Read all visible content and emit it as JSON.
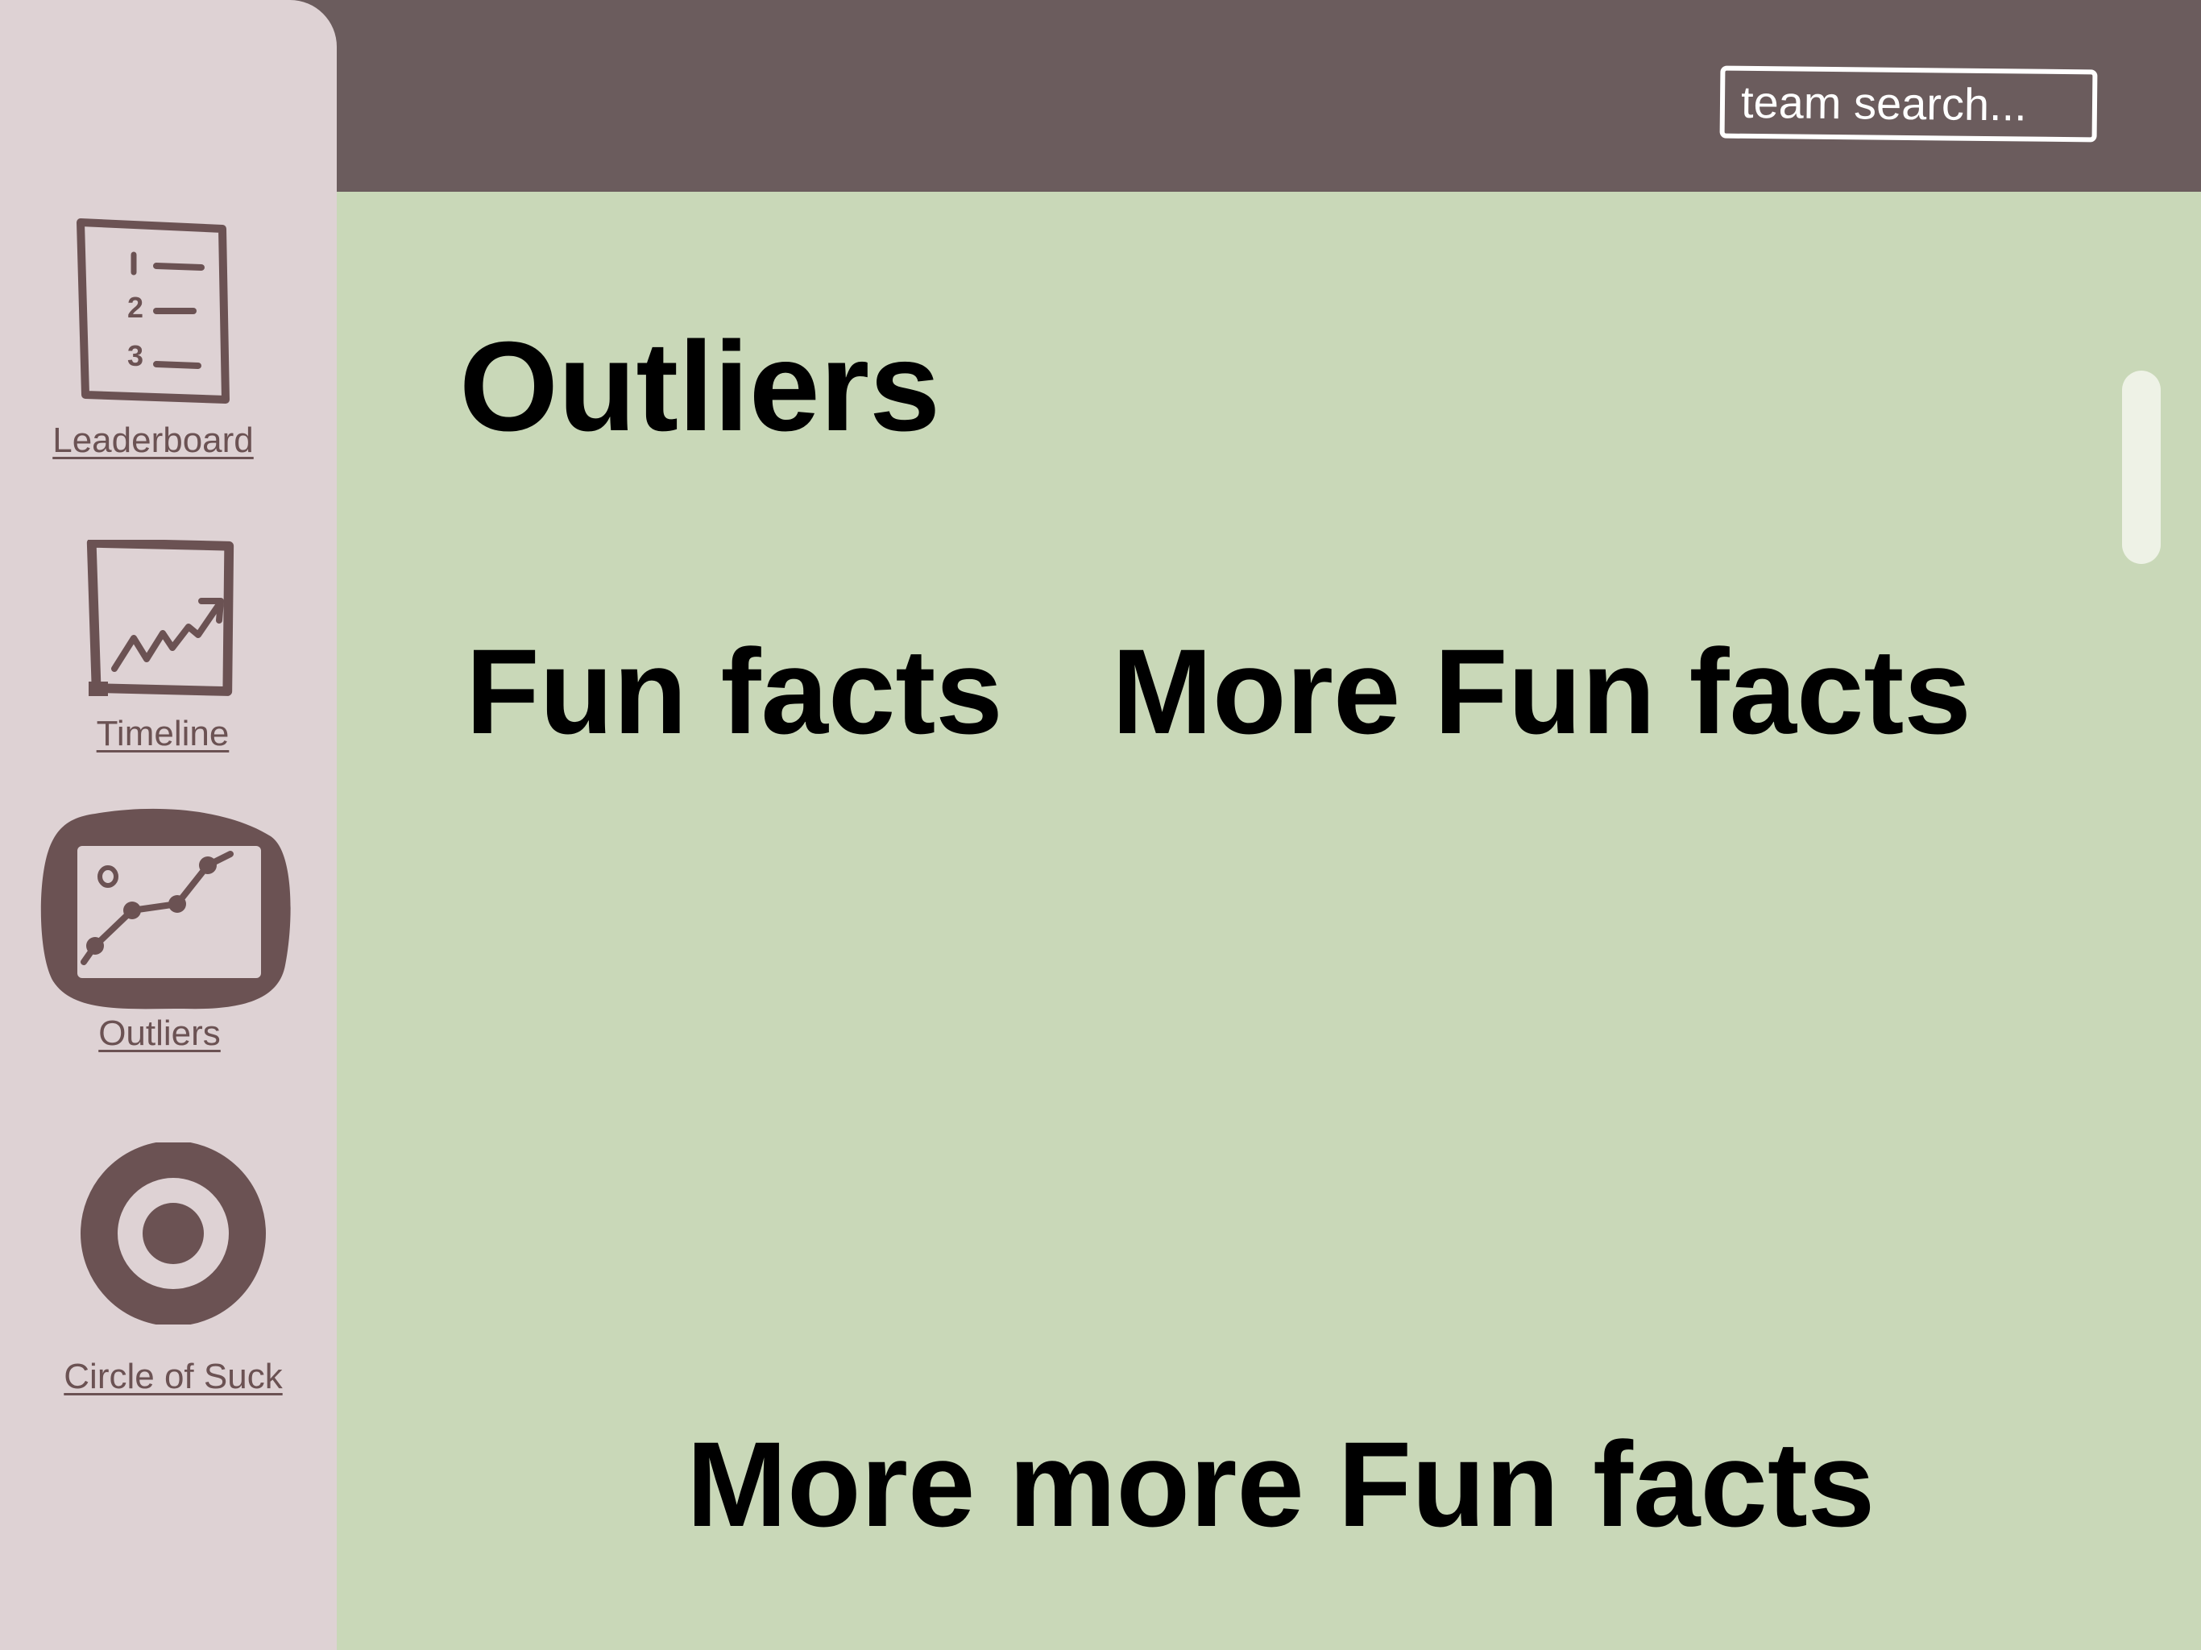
{
  "header": {
    "search_placeholder": "team search..."
  },
  "sidebar": {
    "items": [
      {
        "label": "Leaderboard",
        "icon": "ranked-list-icon"
      },
      {
        "label": "Timeline",
        "icon": "trend-chart-icon"
      },
      {
        "label": "Outliers",
        "icon": "scatter-chart-icon",
        "active": true
      },
      {
        "label": "Circle of Suck",
        "icon": "target-icon"
      }
    ]
  },
  "main": {
    "title": "Outliers",
    "sections": [
      "Fun facts",
      "More Fun facts",
      "More more Fun facts"
    ]
  },
  "colors": {
    "topbar": "#6b5c5d",
    "sidebar": "#ded2d4",
    "content": "#c9d8b8",
    "icon_ink": "#6b5253"
  }
}
